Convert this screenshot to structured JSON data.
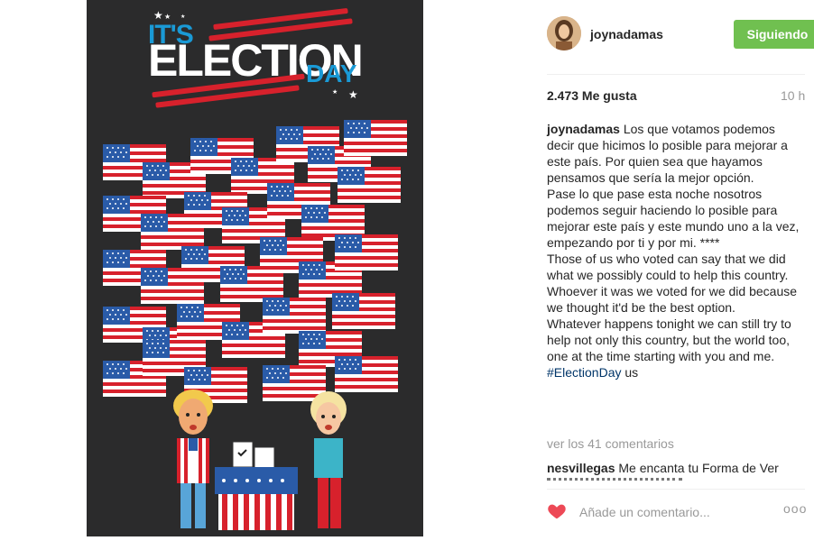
{
  "post_image": {
    "its": "IT'S",
    "election": "ELECTION",
    "day": "DAY"
  },
  "header": {
    "username": "joynadamas",
    "follow_label": "Siguiendo"
  },
  "stats": {
    "likes": "2.473 Me gusta",
    "time": "10 h"
  },
  "caption": {
    "user": "joynadamas",
    "text": "Los que votamos podemos decir que hicimos lo posible para mejorar a este país. Por quien sea que hayamos pensamos que sería la mejor opción.\nPase lo que pase esta noche nosotros podemos seguir haciendo lo posible para mejorar este país y este mundo uno a la vez, empezando por ti y por mi. ****\nThose of us who voted can say that we did what we possibly could to help this country. Whoever it was we voted for we did because we thought it'd be the best option.\nWhatever happens tonight we can still try to help not only this country, but the world too, one at the time starting with you and me.",
    "hashtag": "#ElectionDay",
    "trail": "us"
  },
  "comments": {
    "view_all": "ver los 41 comentarios",
    "first_user": "nesvillegas",
    "first_text": "Me encanta tu Forma de Ver"
  },
  "actions": {
    "comment_placeholder": "Añade un comentario...",
    "more": "ooo"
  },
  "colors": {
    "follow_green": "#70c050",
    "heart_red": "#ed4956",
    "image_bg": "#2b2b2c",
    "flag_red": "#d7212c",
    "flag_blue": "#2a5ba8"
  }
}
